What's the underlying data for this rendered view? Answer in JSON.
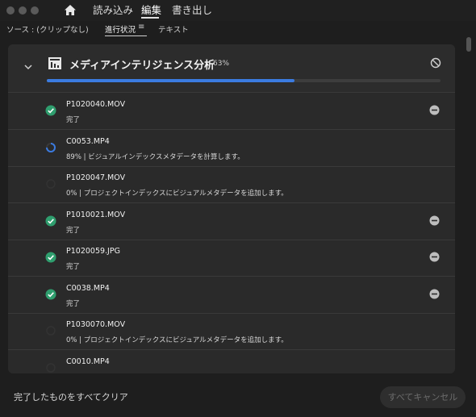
{
  "titlebar": {
    "tabs": [
      {
        "label": "読み込み"
      },
      {
        "label": "編集"
      },
      {
        "label": "書き出し"
      }
    ],
    "active_tab": "編集"
  },
  "toolbar": {
    "source": "ソース : (クリップなし)",
    "tabs": [
      {
        "label": "進行状況"
      },
      {
        "label": "テキスト"
      }
    ],
    "menu_glyph": "≡"
  },
  "panel": {
    "title": "メディアインテリジェンス分析",
    "percent": "63%",
    "progress": 0.63,
    "items": [
      {
        "name": "P1020040.MOV",
        "status": "完了",
        "state": "done"
      },
      {
        "name": "C0053.MP4",
        "status": "89% | ビジュアルインデックスメタデータを計算します。",
        "state": "running"
      },
      {
        "name": "P1020047.MOV",
        "status": "0% | プロジェクトインデックスにビジュアルメタデータを追加します。",
        "state": "pending"
      },
      {
        "name": "P1010021.MOV",
        "status": "完了",
        "state": "done"
      },
      {
        "name": "P1020059.JPG",
        "status": "完了",
        "state": "done"
      },
      {
        "name": "C0038.MP4",
        "status": "完了",
        "state": "done"
      },
      {
        "name": "P1030070.MOV",
        "status": "0% | プロジェクトインデックスにビジュアルメタデータを追加します。",
        "state": "pending"
      },
      {
        "name": "C0010.MP4",
        "status": "",
        "state": "pending"
      }
    ]
  },
  "footer": {
    "clear_label": "完了したものをすべてクリア",
    "cancel_label": "すべてキャンセル"
  },
  "colors": {
    "accent": "#3b7be0",
    "done": "#2f9e6e"
  }
}
